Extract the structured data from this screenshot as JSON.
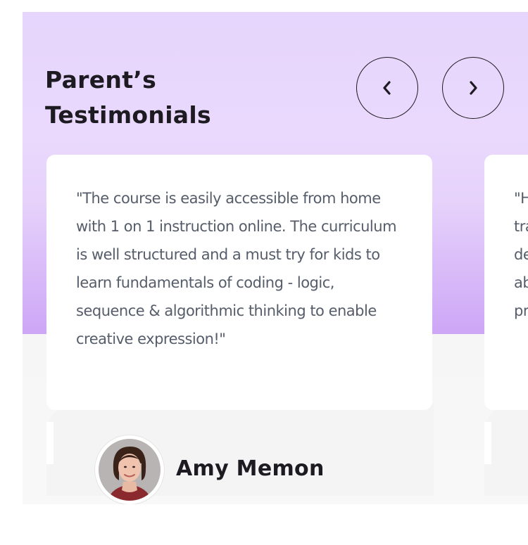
{
  "section": {
    "title_line1": "Parent’s",
    "title_line2": "Testimonials",
    "nav": {
      "prev_icon": "chevron-left-icon",
      "next_icon": "chevron-right-icon"
    }
  },
  "testimonials": [
    {
      "quote": "\"The course is easily accessible from home with 1 on 1 instruction online. The curriculum is well structured and a must try for kids to learn fundamentals of coding - logic, sequence & algorithmic thinking to enable creative expression!\"",
      "author": "Amy Memon"
    },
    {
      "quote_lines": [
        "\"H",
        "tra",
        "de",
        "ab",
        "pr"
      ]
    }
  ],
  "colors": {
    "accent_top": "#e6d5fc",
    "accent_bottom": "#cda6f6",
    "text_dark": "#1d1b21",
    "text_body": "#555d6a"
  }
}
